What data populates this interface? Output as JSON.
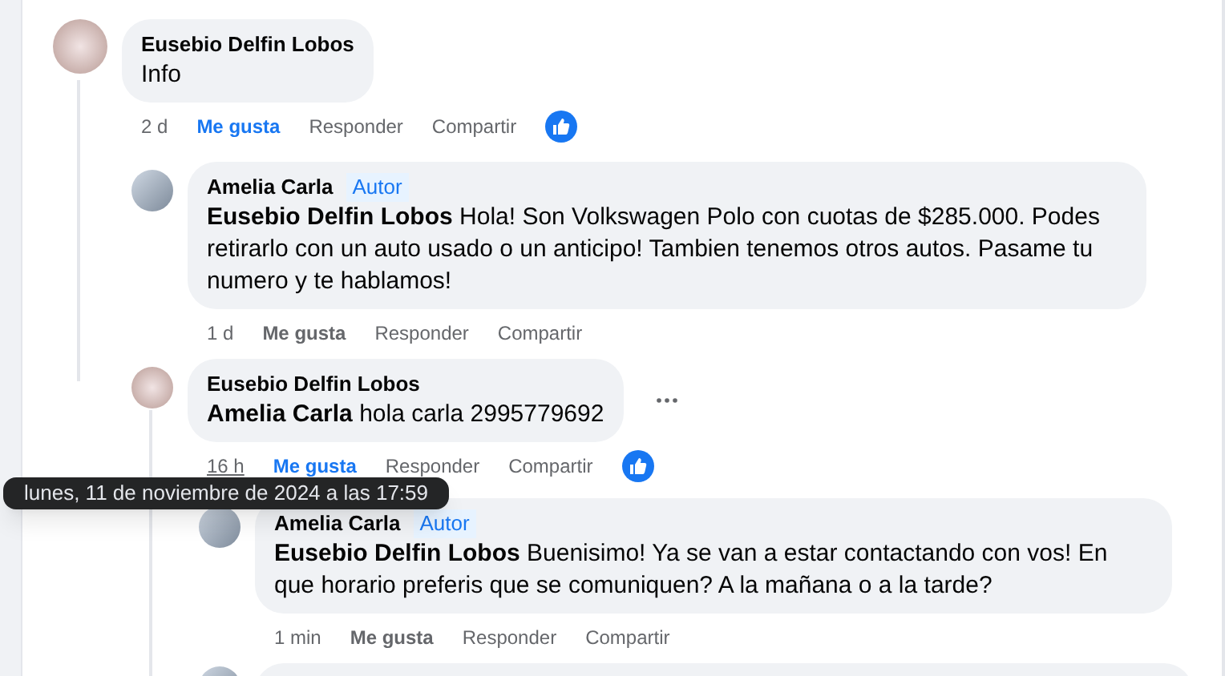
{
  "comments": [
    {
      "author": "Eusebio Delfin Lobos",
      "text": "Info",
      "time": "2 d",
      "liked": true,
      "like_label": "Me gusta",
      "reply_label": "Responder",
      "share_label": "Compartir",
      "time_hovered": false,
      "children": [
        {
          "author": "Amelia Carla",
          "badge": "Autor",
          "mention": "Eusebio Delfin Lobos",
          "text": "Hola! Son Volkswagen Polo con cuotas de $285.000. Podes retirarlo con un auto usado o un anticipo! Tambien tenemos otros autos. Pasame tu numero y te hablamos!",
          "time": "1 d",
          "liked": false,
          "like_label": "Me gusta",
          "reply_label": "Responder",
          "share_label": "Compartir",
          "time_hovered": false
        },
        {
          "author": "Eusebio Delfin Lobos",
          "mention": "Amelia Carla",
          "text": "hola carla 2995779692",
          "time": "16 h",
          "liked": true,
          "like_label": "Me gusta",
          "reply_label": "Responder",
          "share_label": "Compartir",
          "time_hovered": true,
          "more_menu": true,
          "children": [
            {
              "author": "Amelia Carla",
              "badge": "Autor",
              "mention": "Eusebio Delfin Lobos",
              "text": "Buenisimo! Ya se van a estar contactando con vos! En que horario preferis que se comuniquen? A la mañana o a la tarde?",
              "time": "1 min",
              "liked": false,
              "like_label": "Me gusta",
              "reply_label": "Responder",
              "share_label": "Compartir",
              "time_hovered": false
            }
          ]
        }
      ]
    }
  ],
  "tooltip": "lunes, 11 de noviembre de 2024 a las 17:59"
}
